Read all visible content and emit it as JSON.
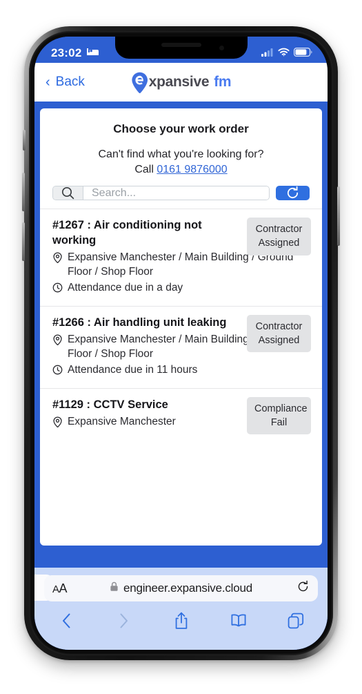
{
  "status_bar": {
    "time": "23:02",
    "focus_icon": "bed-icon",
    "cellular_icon": "cellular-signal-icon",
    "wifi_icon": "wifi-icon",
    "battery_icon": "battery-icon"
  },
  "nav": {
    "back_label": "Back",
    "back_icon": "chevron-left-icon",
    "brand_word": "xpansive",
    "brand_fm": "fm",
    "brand_pin_letter": "e"
  },
  "main": {
    "title": "Choose your work order",
    "subtitle": "Can't find what you're looking for?",
    "call_prefix": "Call",
    "phone_number": "0161 9876000",
    "search": {
      "placeholder": "Search...",
      "value": "",
      "icon": "search-icon",
      "refresh_icon": "refresh-icon"
    },
    "work_orders": [
      {
        "title": "#1267 : Air conditioning not working",
        "location": "Expansive Manchester / Main Building / Ground Floor / Shop Floor",
        "due": "Attendance due in a day",
        "badge": "Contractor Assigned",
        "location_icon": "map-pin-icon",
        "due_icon": "clock-icon"
      },
      {
        "title": "#1266 : Air handling unit leaking",
        "location": "Expansive Manchester / Main Building / Ground Floor / Shop Floor",
        "due": "Attendance due in 11 hours",
        "badge": "Contractor Assigned",
        "location_icon": "map-pin-icon",
        "due_icon": "clock-icon"
      },
      {
        "title": "#1129 : CCTV Service",
        "location": "Expansive Manchester",
        "due": "",
        "badge": "Compliance Fail",
        "location_icon": "map-pin-icon",
        "due_icon": "clock-icon"
      }
    ]
  },
  "browser": {
    "text_size_label": "AA",
    "lock_icon": "lock-icon",
    "url": "engineer.expansive.cloud",
    "reload_icon": "reload-icon",
    "toolbar": {
      "back_icon": "back-arrow-icon",
      "forward_icon": "forward-arrow-icon",
      "share_icon": "share-icon",
      "bookmarks_icon": "book-icon",
      "tabs_icon": "tabs-icon"
    }
  },
  "colors": {
    "brand_blue": "#2d5fd1",
    "accent_blue": "#2f6fe0",
    "link_blue": "#3166d6",
    "badge_bg": "#e2e3e5",
    "safari_bg": "#c8d8f8"
  }
}
